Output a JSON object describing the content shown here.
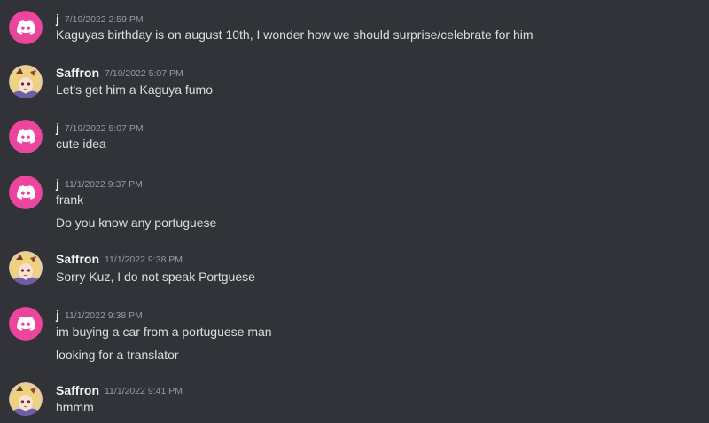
{
  "messages": [
    {
      "author": "j",
      "avatar_icon": "discord-logo-icon",
      "timestamp": "7/19/2022 2:59 PM",
      "lines": [
        "Kaguyas birthday is on august 10th, I wonder how we should surprise/celebrate for him"
      ]
    },
    {
      "author": "Saffron",
      "avatar_icon": "anime-character-avatar-icon",
      "timestamp": "7/19/2022 5:07 PM",
      "lines": [
        "Let's get him a Kaguya fumo"
      ]
    },
    {
      "author": "j",
      "avatar_icon": "discord-logo-icon",
      "timestamp": "7/19/2022 5:07 PM",
      "lines": [
        "cute idea"
      ]
    },
    {
      "author": "j",
      "avatar_icon": "discord-logo-icon",
      "timestamp": "11/1/2022 9:37 PM",
      "lines": [
        "frank",
        "Do you know any portuguese"
      ]
    },
    {
      "author": "Saffron",
      "avatar_icon": "anime-character-avatar-icon",
      "timestamp": "11/1/2022 9:38 PM",
      "lines": [
        "Sorry Kuz, I do not speak Portguese"
      ]
    },
    {
      "author": "j",
      "avatar_icon": "discord-logo-icon",
      "timestamp": "11/1/2022 9:38 PM",
      "lines": [
        "im buying a car from a portuguese man",
        "looking for a translator"
      ]
    },
    {
      "author": "Saffron",
      "avatar_icon": "anime-character-avatar-icon",
      "timestamp": "11/1/2022 9:41 PM",
      "lines": [
        "hmmm"
      ]
    }
  ],
  "colors": {
    "background": "#313338",
    "discord_avatar_bg": "#eb459e",
    "username": "#f2f3f5",
    "timestamp": "#949ba4",
    "message_text": "#dbdee1"
  }
}
